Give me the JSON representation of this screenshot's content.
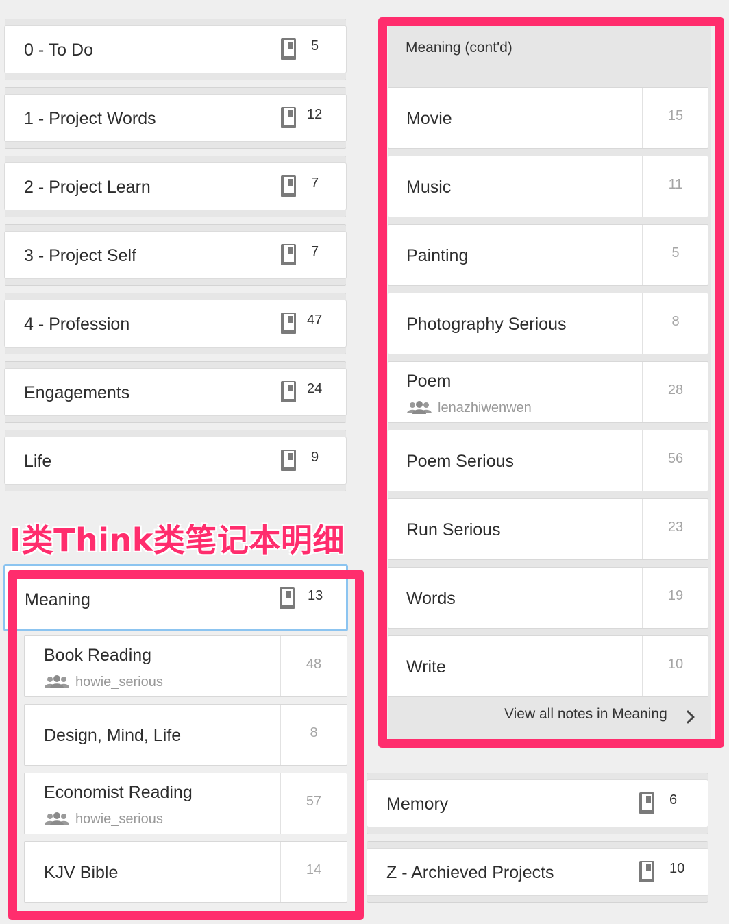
{
  "notebooks_left": [
    {
      "name": "0 - To Do",
      "count": "5"
    },
    {
      "name": "1 - Project Words",
      "count": "12"
    },
    {
      "name": "2 - Project Learn",
      "count": "7"
    },
    {
      "name": "3 - Project Self",
      "count": "7"
    },
    {
      "name": "4 - Profession",
      "count": "47"
    },
    {
      "name": "Engagements",
      "count": "24"
    },
    {
      "name": "Life",
      "count": "9"
    }
  ],
  "annotation": "I类Think类笔记本明细",
  "stack": {
    "name": "Meaning",
    "count": "13",
    "items": [
      {
        "name": "Book Reading",
        "owner": "howie_serious",
        "count": "48"
      },
      {
        "name": "Design, Mind, Life",
        "owner": "",
        "count": "8"
      },
      {
        "name": "Economist Reading",
        "owner": "howie_serious",
        "count": "57"
      },
      {
        "name": "KJV Bible",
        "owner": "",
        "count": "14"
      }
    ]
  },
  "contd_panel": {
    "title": "Meaning (cont'd)",
    "items": [
      {
        "name": "Movie",
        "owner": "",
        "count": "15"
      },
      {
        "name": "Music",
        "owner": "",
        "count": "11"
      },
      {
        "name": "Painting",
        "owner": "",
        "count": "5"
      },
      {
        "name": "Photography Serious",
        "owner": "",
        "count": "8"
      },
      {
        "name": "Poem",
        "owner": "lenazhiwenwen",
        "count": "28"
      },
      {
        "name": "Poem Serious",
        "owner": "",
        "count": "56"
      },
      {
        "name": "Run Serious",
        "owner": "",
        "count": "23"
      },
      {
        "name": "Words",
        "owner": "",
        "count": "19"
      },
      {
        "name": "Write",
        "owner": "",
        "count": "10"
      }
    ],
    "view_all": "View all notes in Meaning"
  },
  "notebooks_right": [
    {
      "name": "Memory",
      "count": "6"
    },
    {
      "name": "Z - Archieved Projects",
      "count": "10"
    }
  ],
  "icons": {
    "notebook": "notebook-icon",
    "shared": "shared-people-icon",
    "chevron": "chevron-right-icon"
  },
  "colors": {
    "highlight": "#ff2d6d",
    "selected_border": "#8cc4f0",
    "background": "#efefef"
  }
}
